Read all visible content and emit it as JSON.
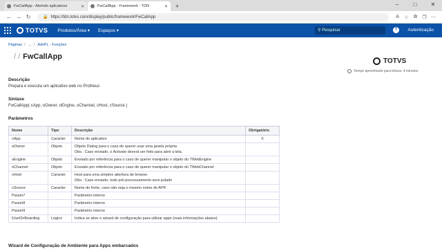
{
  "browser": {
    "tabs": [
      {
        "title": "FwCallApp - Abrindo aplicativos",
        "active": false
      },
      {
        "title": "FwCallApp - Framework - TDN",
        "active": true
      }
    ],
    "url": "https://tdn.totvs.com/display/public/framework/FwCallApp"
  },
  "header": {
    "logo": "TOTVS",
    "menu": [
      "Produtos/Área",
      "Espaços"
    ],
    "search_placeholder": "Pesquisar",
    "login_label": "Autenticação"
  },
  "breadcrumb": [
    "Páginas",
    "...",
    "AdvPL - Funções"
  ],
  "page": {
    "title": "FwCallApp",
    "brand": "TOTVS",
    "read_time": "Tempo aproximado para leitura: 4 minutos"
  },
  "description": {
    "heading": "Descrição",
    "text": "Prepara e executa um aplicativo web no Protheus"
  },
  "syntax": {
    "heading": "Sintaxe",
    "text": "FwCallApp( cApp, oOwner, oEngine, oChannel, cHost, cSource )"
  },
  "params": {
    "heading": "Parâmetros",
    "columns": [
      "Nome",
      "Tipo",
      "Descrição",
      "Obrigatório"
    ],
    "rows": [
      {
        "nome": "cApp",
        "tipo": "Caracter",
        "desc1": "Nome do aplicativo",
        "desc2": "",
        "obrig": "X"
      },
      {
        "nome": "oOwner",
        "tipo": "Objeto",
        "desc1": "Objeto Dialog para o caso de querer usar uma janela própria",
        "desc2": "Obs.: Caso enviado, o Activate deverá ser feito para abrir a tela.",
        "obrig": ""
      },
      {
        "nome": "oEngine",
        "tipo": "Objeto",
        "desc1": "Enviado por referência para o caso de querer manipular o objeto do TWebEngine",
        "desc2": "",
        "obrig": ""
      },
      {
        "nome": "oChannel",
        "tipo": "Objeto",
        "desc1": "Enviado por referência para o caso de querer manipular o objeto do TWebChannel",
        "desc2": "",
        "obrig": ""
      },
      {
        "nome": "cHost",
        "tipo": "Caracter",
        "desc1": "Host para uma simples abertura de browse.",
        "desc2": "Obs.: Caso enviado, todo pré-processamento será pulado",
        "obrig": ""
      },
      {
        "nome": "cSource",
        "tipo": "Caracter",
        "desc1": "Nome do fonte, caso não seja o mesmo nome do APP.",
        "desc2": "",
        "obrig": ""
      },
      {
        "nome": "Param7",
        "tipo": "",
        "desc1": "Parâmetro interno",
        "desc2": "",
        "obrig": ""
      },
      {
        "nome": "Param8",
        "tipo": "",
        "desc1": "Parâmetro interno",
        "desc2": "",
        "obrig": ""
      },
      {
        "nome": "Param9",
        "tipo": "",
        "desc1": "Parâmetro interno",
        "desc2": "",
        "obrig": ""
      },
      {
        "nome": "lUseOnBoarding",
        "tipo": "Lógico",
        "desc1": "Indica se abre o wizard de configuração para utilizar apps (mais informações abaixo)",
        "desc2": "",
        "obrig": ""
      }
    ]
  },
  "bottom_heading": "Wizard de Configuração de Ambiente para Apps embarcados"
}
